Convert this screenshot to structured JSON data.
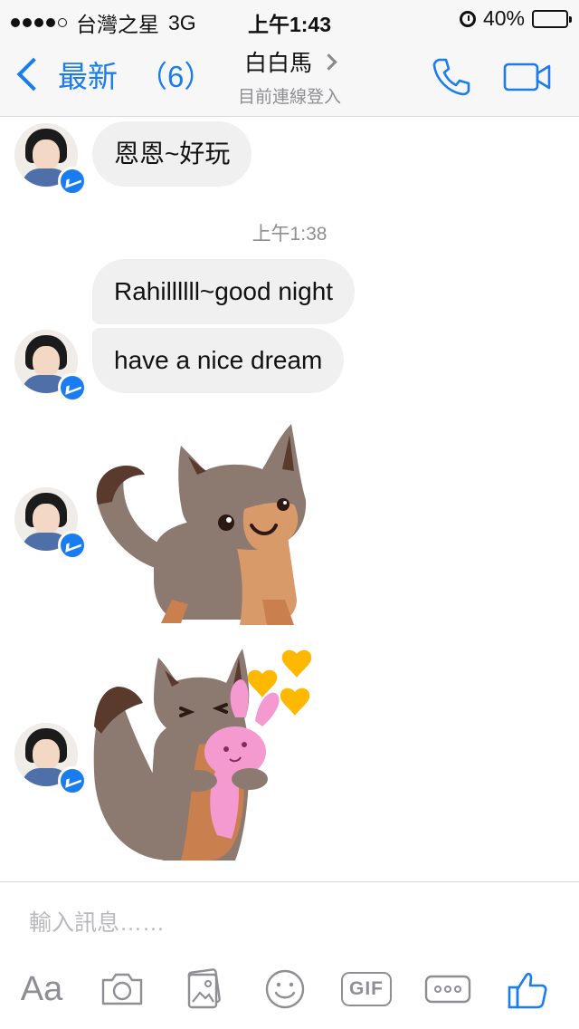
{
  "status_bar": {
    "carrier": "台灣之星",
    "network": "3G",
    "time": "上午1:43",
    "battery": "40%",
    "battery_level": 0.4,
    "signal_dots_filled": 4,
    "signal_dots_total": 5
  },
  "nav": {
    "back_label": "最新",
    "unread_count": "（6）",
    "contact_name": "白白馬",
    "presence": "目前連線登入"
  },
  "messages": {
    "m1": "恩恩~好玩",
    "timestamp": "上午1:38",
    "m2": "Rahillllll~good night",
    "m3": "have a nice dream"
  },
  "composer": {
    "placeholder": "輸入訊息……"
  },
  "toolbar": {
    "text_label": "Aa",
    "gif_label": "GIF"
  },
  "colors": {
    "accent": "#1a7cf1",
    "bubble": "#f1f0f0",
    "battery_fill": "#f5c400",
    "heart": "#ffb800"
  }
}
